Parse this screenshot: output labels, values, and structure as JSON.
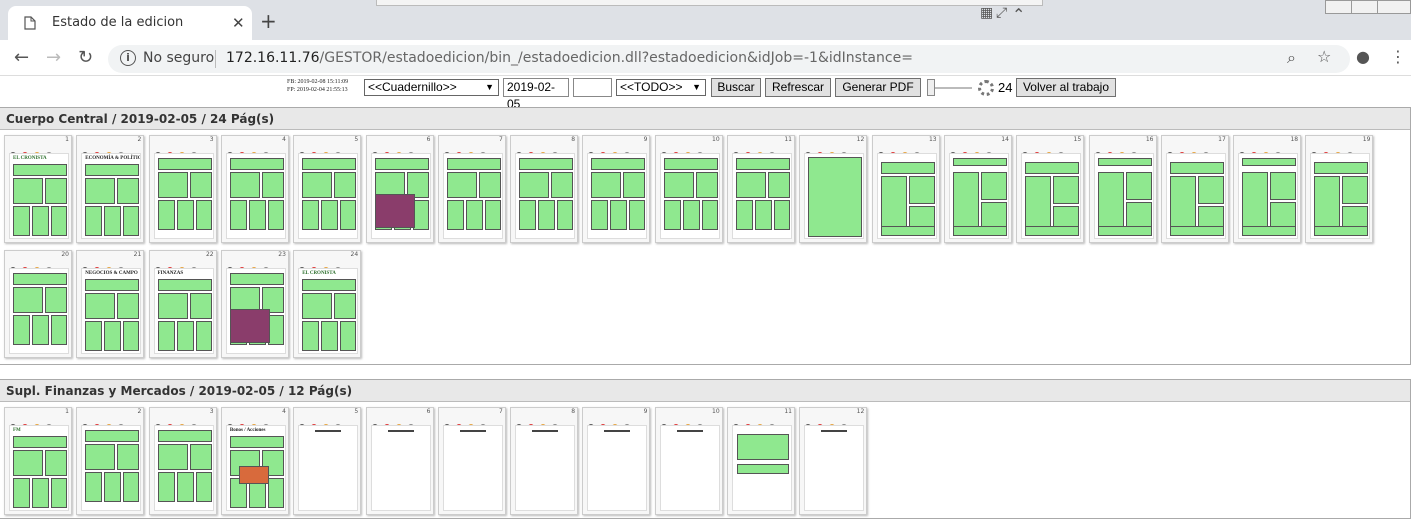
{
  "browser": {
    "tab_title": "Estado de la edicion",
    "security_label": "No seguro",
    "url_host": "172.16.11.76",
    "url_path": "/GESTOR/estadoedicion/bin_/estadoedicion.dll?estadoedicion&idJob=-1&idInstance="
  },
  "controls": {
    "fb": "FB: 2019-02-08 15:11:09",
    "fp": "FP: 2019-02-04 21:55:13",
    "cuadernillo": "<<Cuadernillo>>",
    "fecha": "2019-02-05",
    "extra": "",
    "filtro": "<<TODO>>",
    "buscar": "Buscar",
    "refrescar": "Refrescar",
    "generar_pdf": "Generar PDF",
    "zoom": "24",
    "volver": "Volver al trabajo"
  },
  "sections": [
    {
      "title": "Cuerpo Central / 2019-02-05 / 24 Pág(s)",
      "pages": [
        "1",
        "2",
        "3",
        "4",
        "5",
        "6",
        "7",
        "8",
        "9",
        "10",
        "11",
        "12",
        "13",
        "14",
        "15",
        "16",
        "17",
        "18",
        "19",
        "20",
        "21",
        "22",
        "23",
        "24"
      ],
      "headlines": {
        "1": "EL CRONISTA",
        "2": "ECONOMÍA & POLÍTICA",
        "21": "NEGOCIOS & CAMPO",
        "22": "FINANZAS",
        "24": "EL CRONISTA"
      }
    },
    {
      "title": "Supl. Finanzas y Mercados / 2019-02-05 / 12 Pág(s)",
      "pages": [
        "1",
        "2",
        "3",
        "4",
        "5",
        "6",
        "7",
        "8",
        "9",
        "10",
        "11",
        "12"
      ],
      "headlines": {
        "1": "FM",
        "4": "Bonos / Acciones"
      }
    }
  ],
  "colors": {
    "filled": "#8fe88f",
    "magenta": "#8a3d6b",
    "header_bg": "#e8e8e8"
  }
}
